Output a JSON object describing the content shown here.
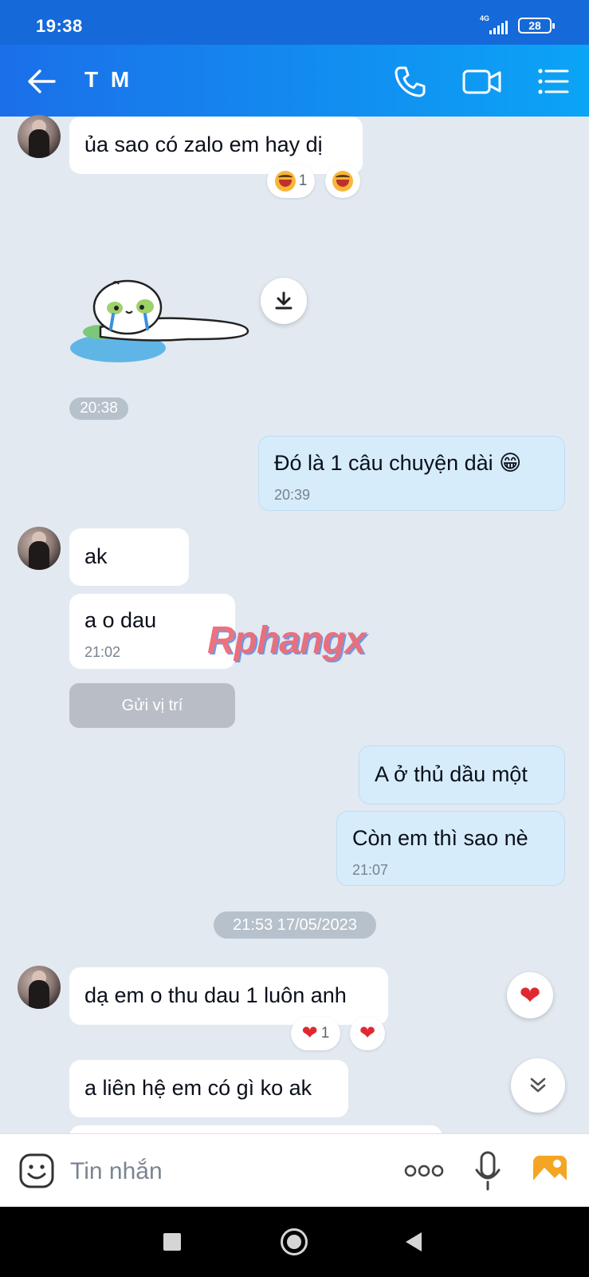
{
  "status_bar": {
    "time": "19:38",
    "network": "4G",
    "battery": "28"
  },
  "header": {
    "contact_name": "T M",
    "icons": [
      "back-arrow-icon",
      "phone-icon",
      "video-call-icon",
      "menu-list-icon"
    ]
  },
  "messages": [
    {
      "from": "contact",
      "text": "ủa sao có zalo em hay dị",
      "reaction_count": "1",
      "reaction": "laugh-emoji"
    },
    {
      "from": "contact",
      "type": "sticker",
      "description_icon": "crying-sticker",
      "time": "20:38"
    },
    {
      "from": "me",
      "text": "Đó là 1 câu chuyện dài 😁",
      "time": "20:39"
    },
    {
      "from": "contact",
      "text": "ak"
    },
    {
      "from": "contact",
      "text": "a o dau",
      "time": "21:02"
    },
    {
      "from": "contact",
      "type": "location",
      "text": "Gửi vị trí"
    },
    {
      "from": "me",
      "text": "A ở thủ dầu một"
    },
    {
      "from": "me",
      "text": "Còn em thì sao nè",
      "time": "21:07"
    },
    {
      "type": "date_separator",
      "text": "21:53 17/05/2023"
    },
    {
      "from": "contact",
      "text": "dạ em o thu dau 1 luôn anh",
      "reaction_count": "1",
      "reaction": "heart"
    },
    {
      "from": "contact",
      "text": "a liên hệ em có gì ko ak"
    }
  ],
  "watermark": "Rphangx",
  "composer": {
    "placeholder": "Tin nhắn"
  },
  "colors": {
    "header_start": "#1b6fe9",
    "header_end": "#0ba4f6",
    "my_bubble": "#d6ecfb",
    "chat_bg": "#e2e9f1"
  }
}
